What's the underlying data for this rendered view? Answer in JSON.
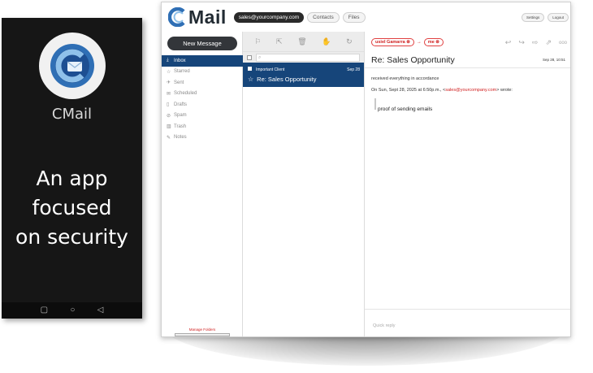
{
  "phone": {
    "app_name": "CMail",
    "tagline_lines": [
      "An app",
      "focused",
      "on security"
    ],
    "nav": {
      "square": "▢",
      "circle": "○",
      "back": "◁"
    }
  },
  "topbar": {
    "brand": "Mail",
    "account": "sales@yourcompany.com",
    "contacts": "Contacts",
    "files": "Files",
    "settings": "Settings",
    "logout": "Logout"
  },
  "sidebar": {
    "new_message": "New Message",
    "items": [
      {
        "label": "Inbox",
        "icon": "⤓"
      },
      {
        "label": "Starred",
        "icon": "☆"
      },
      {
        "label": "Sent",
        "icon": "✈"
      },
      {
        "label": "Scheduled",
        "icon": "✉"
      },
      {
        "label": "Drafts",
        "icon": "▯"
      },
      {
        "label": "Spam",
        "icon": "⊘"
      },
      {
        "label": "Trash",
        "icon": "▥"
      },
      {
        "label": "Notes",
        "icon": "✎"
      }
    ],
    "manage_folders": "Manage Folders"
  },
  "list": {
    "toolbar_icons": [
      "⚐",
      "⇱",
      "🗑",
      "✋",
      "↻"
    ],
    "search_placeholder": "⌕",
    "messages": [
      {
        "label": "Important Client",
        "date": "Sep 28",
        "subject": "Re: Sales Opportunity"
      }
    ]
  },
  "read": {
    "from": "usiel Gamarra ⊗",
    "arrow": "→",
    "to": "me ⊗",
    "actions": [
      "↩",
      "↪",
      "⇨",
      "⇗",
      "ooo"
    ],
    "subject": "Re: Sales Opportunity",
    "date": "Sep 28, 10:51",
    "body_line1": "received everything in accordance",
    "quote_prefix": "On Sun, Sept 28, 2025 at 6:50p.m., <",
    "quote_email": "sales@yourcompany.com",
    "quote_suffix": "> wrote:",
    "quoted_text": "proof of sending emails",
    "quick_reply": "Quick reply"
  },
  "colors": {
    "accent": "#16457a",
    "danger": "#d02020",
    "dark_button": "#33363a"
  }
}
